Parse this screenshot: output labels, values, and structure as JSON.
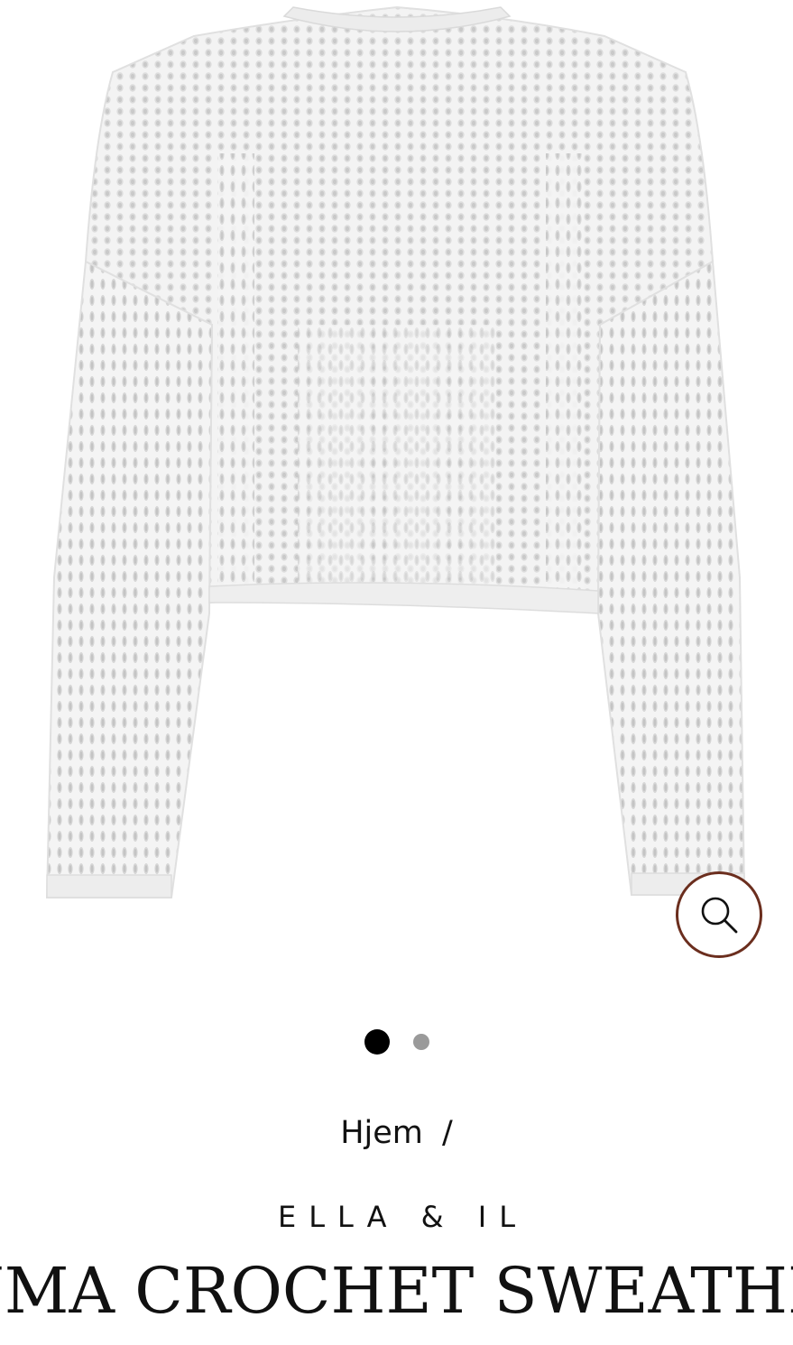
{
  "gallery": {
    "image_alt": "white crochet sweater",
    "zoom_icon": "search-icon",
    "zoom_border_color": "#6b2e1e",
    "slides_total": 2,
    "active_slide": 1
  },
  "breadcrumb": {
    "home_label": "Hjem",
    "separator": "/"
  },
  "product": {
    "brand": "ELLA & IL",
    "title": "LUMA CROCHET SWEATHER"
  }
}
